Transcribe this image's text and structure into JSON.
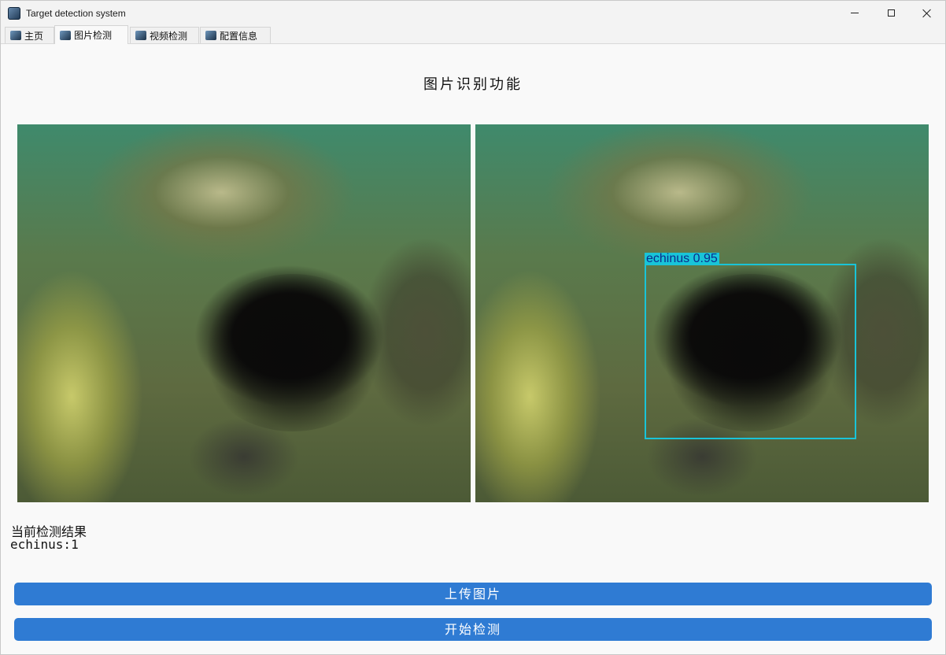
{
  "window": {
    "title": "Target detection system",
    "icon": "app-logo-icon",
    "controls": [
      "minimize-icon",
      "maximize-icon",
      "close-icon"
    ]
  },
  "tabs": [
    {
      "label": "主页",
      "active": false
    },
    {
      "label": "图片检测",
      "active": true
    },
    {
      "label": "视频检测",
      "active": false
    },
    {
      "label": "配置信息",
      "active": false
    }
  ],
  "main": {
    "title": "图片识别功能",
    "detection": {
      "label": "echinus  0.95",
      "class": "echinus",
      "confidence": 0.95,
      "box_color": "#19c4d8",
      "label_text_color": "#0a2d8c"
    },
    "result_title": "当前检测结果",
    "result_value": "echinus:1",
    "upload_button": "上传图片",
    "detect_button": "开始检测"
  },
  "colors": {
    "accent": "#2f7bd3",
    "background": "#f9f9f9"
  }
}
